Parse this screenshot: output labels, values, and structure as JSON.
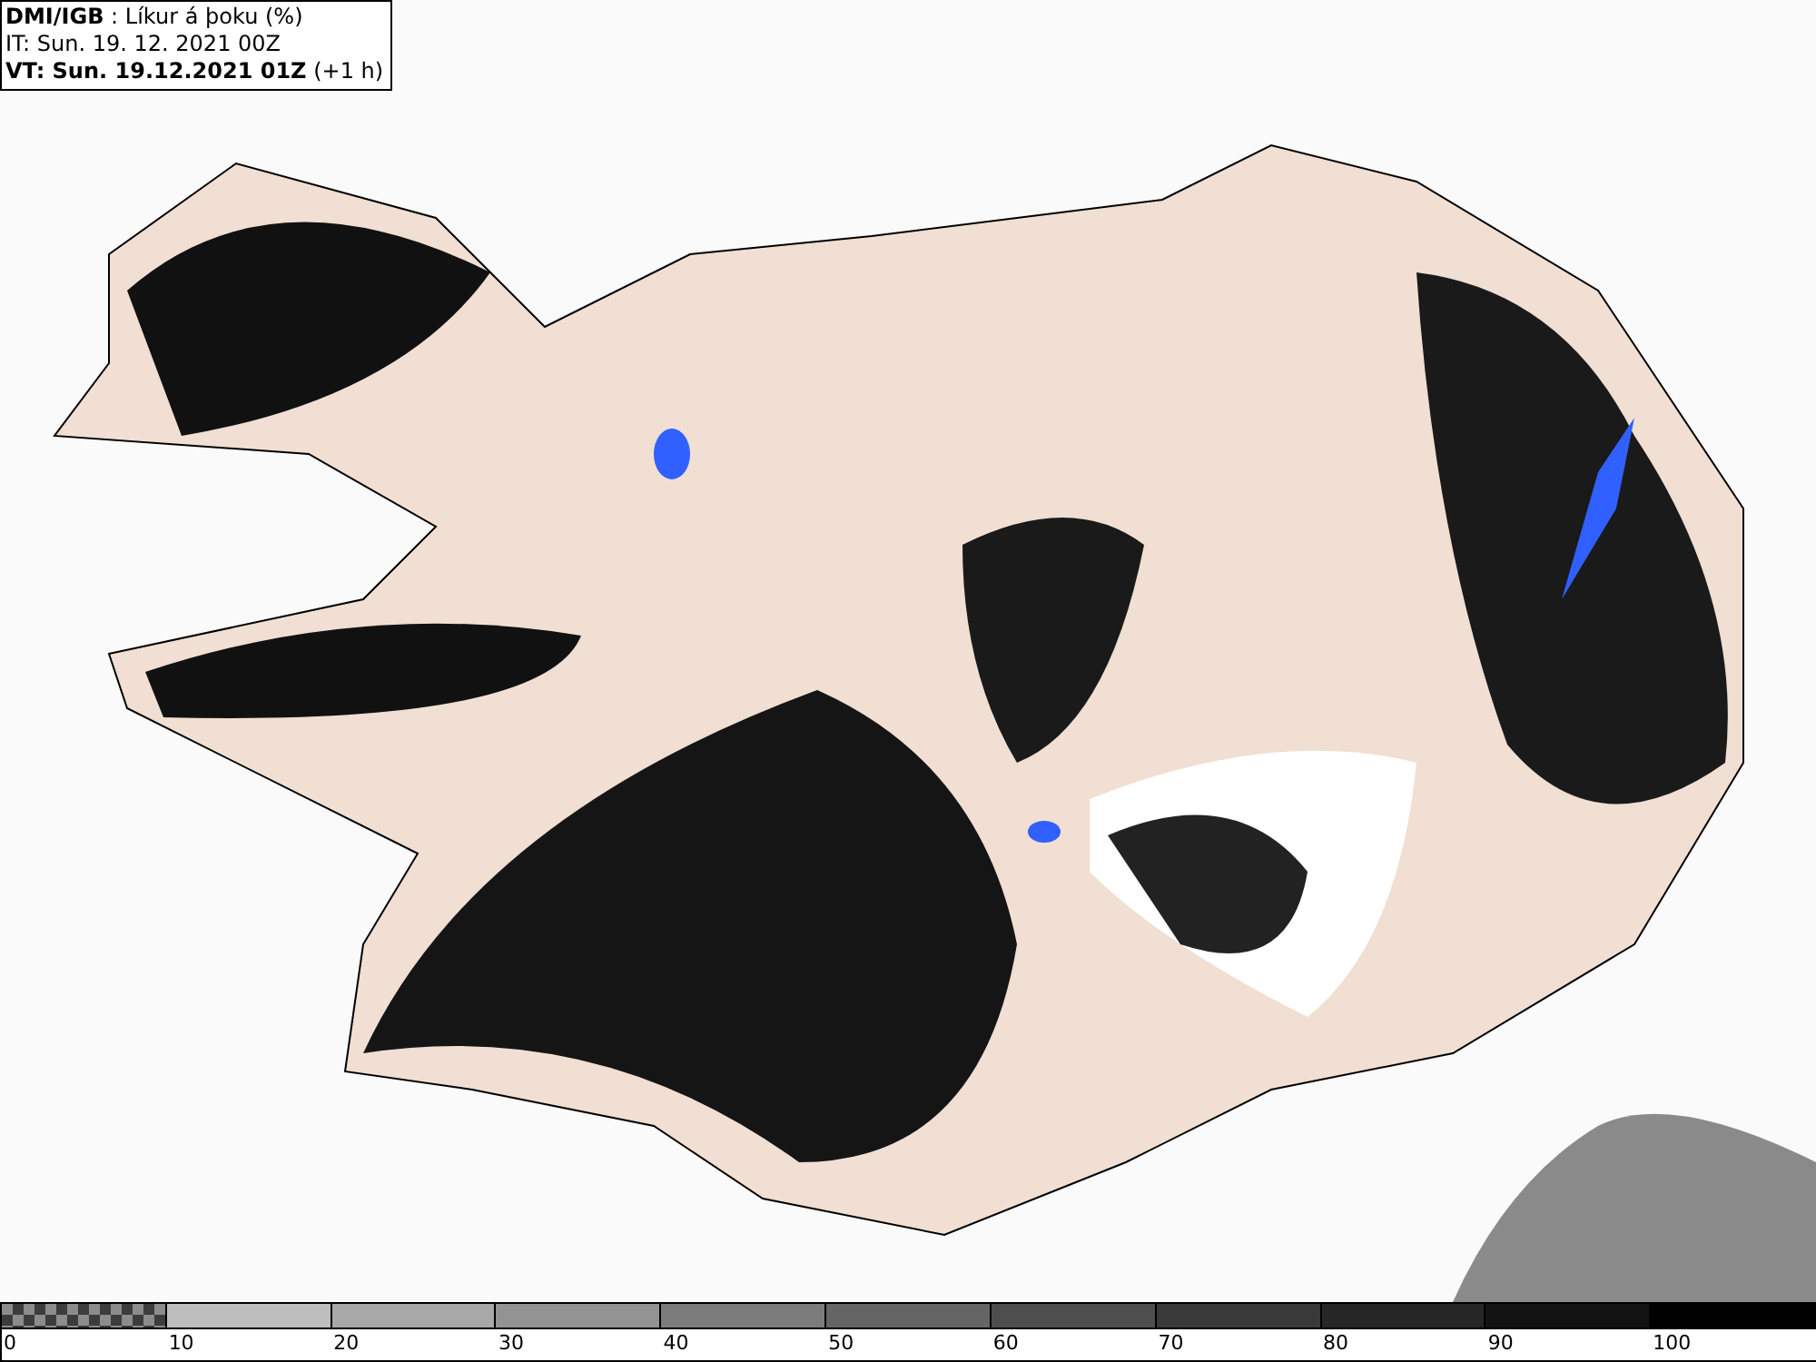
{
  "header": {
    "source": "DMI/IGB",
    "parameter": ": Líkur á þoku (%)",
    "issue_time": "IT: Sun. 19. 12. 2021 00Z",
    "valid_time": "VT: Sun. 19.12.2021 01Z",
    "offset": "(+1 h)"
  },
  "legend": [
    {
      "kind": "checker",
      "color": "#3c3c3c",
      "label": "0"
    },
    {
      "kind": "solid",
      "color": "#bdbdbd",
      "label": "10"
    },
    {
      "kind": "solid",
      "color": "#a8a8a8",
      "label": "20"
    },
    {
      "kind": "solid",
      "color": "#939393",
      "label": "30"
    },
    {
      "kind": "solid",
      "color": "#7c7c7c",
      "label": "40"
    },
    {
      "kind": "solid",
      "color": "#656565",
      "label": "50"
    },
    {
      "kind": "solid",
      "color": "#4e4e4e",
      "label": "60"
    },
    {
      "kind": "solid",
      "color": "#393939",
      "label": "70"
    },
    {
      "kind": "solid",
      "color": "#262626",
      "label": "80"
    },
    {
      "kind": "solid",
      "color": "#121212",
      "label": "90"
    },
    {
      "kind": "solid",
      "color": "#000000",
      "label": "100"
    }
  ]
}
